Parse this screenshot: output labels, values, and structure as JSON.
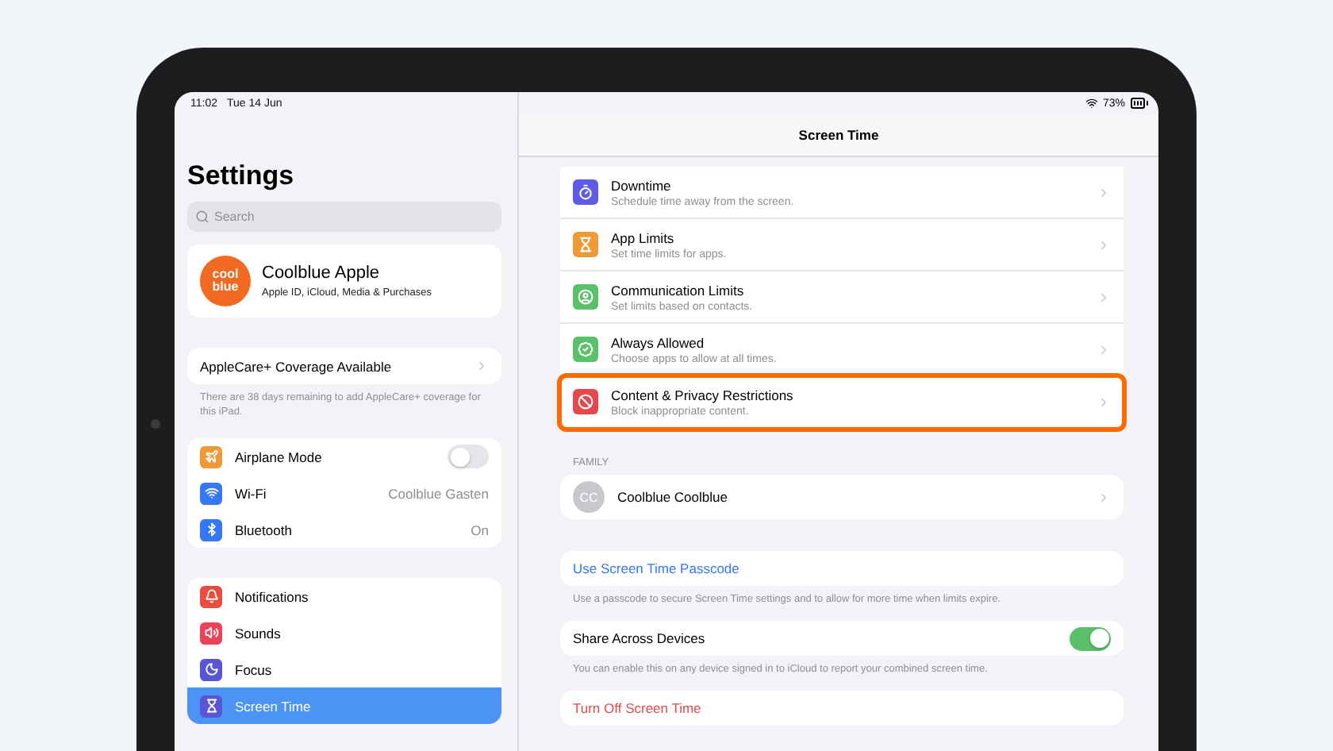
{
  "status_bar": {
    "time": "11:02",
    "date": "Tue 14 Jun",
    "battery": "73%"
  },
  "sidebar": {
    "title": "Settings",
    "search": {
      "placeholder": "Search"
    },
    "profile": {
      "avatar_lines": [
        "cool",
        "blue"
      ],
      "name": "Coolblue Apple",
      "subtitle": "Apple ID, iCloud, Media & Purchases"
    },
    "applecare": {
      "label": "AppleCare+ Coverage Available",
      "note": "There are 38 days remaining to add AppleCare+ coverage for this iPad."
    },
    "groups": [
      [
        {
          "kind": "toggle",
          "label": "Airplane Mode",
          "on": false,
          "color": "#f09a37",
          "selected": false
        },
        {
          "kind": "value",
          "label": "Wi-Fi",
          "value": "Coolblue Gasten",
          "color": "#3478f6",
          "selected": false
        },
        {
          "kind": "value",
          "label": "Bluetooth",
          "value": "On",
          "color": "#3478f6",
          "selected": false
        }
      ],
      [
        {
          "kind": "link",
          "label": "Notifications",
          "color": "#eb4d3d",
          "selected": false
        },
        {
          "kind": "link",
          "label": "Sounds",
          "color": "#eb445a",
          "selected": false
        },
        {
          "kind": "link",
          "label": "Focus",
          "color": "#5856d6",
          "selected": false
        },
        {
          "kind": "link",
          "label": "Screen Time",
          "color": "#5856d6",
          "selected": true
        }
      ]
    ]
  },
  "detail": {
    "title": "Screen Time",
    "features": [
      {
        "title": "Downtime",
        "subtitle": "Schedule time away from the screen.",
        "color": "#5e5ce6",
        "highlighted": false
      },
      {
        "title": "App Limits",
        "subtitle": "Set time limits for apps.",
        "color": "#f09a37",
        "highlighted": false
      },
      {
        "title": "Communication Limits",
        "subtitle": "Set limits based on contacts.",
        "color": "#5bc06a",
        "highlighted": false
      },
      {
        "title": "Always Allowed",
        "subtitle": "Choose apps to allow at all times.",
        "color": "#5bc06a",
        "highlighted": false
      },
      {
        "title": "Content & Privacy Restrictions",
        "subtitle": "Block inappropriate content.",
        "color": "#e5484d",
        "highlighted": true
      }
    ],
    "family": {
      "header": "FAMILY",
      "members": [
        {
          "initials": "CC",
          "name": "Coolblue Coolblue"
        }
      ]
    },
    "passcode": {
      "label": "Use Screen Time Passcode",
      "note": "Use a passcode to secure Screen Time settings and to allow for more time when limits expire."
    },
    "share": {
      "label": "Share Across Devices",
      "on": true,
      "note": "You can enable this on any device signed in to iCloud to report your combined screen time."
    },
    "turn_off": {
      "label": "Turn Off Screen Time"
    }
  }
}
